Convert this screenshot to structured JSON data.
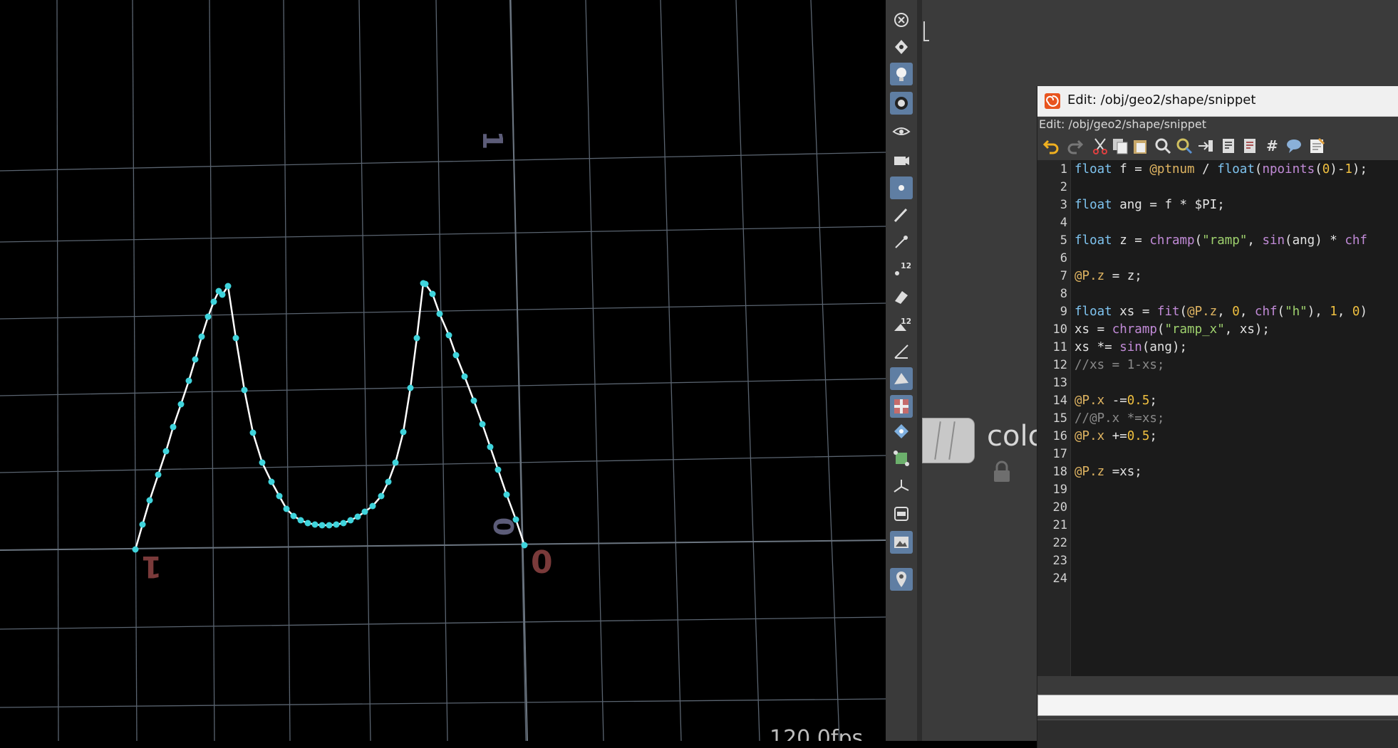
{
  "viewport": {
    "fps_text": "120.0fps",
    "axis_labels": {
      "y_top": "1",
      "x_left": "1",
      "z_origin": "0",
      "x_origin": "0"
    },
    "colors": {
      "grid": "#5a6470",
      "curve": "#ffffff",
      "points": "#3fd4dc",
      "y_label": "#5c5c78",
      "x_label": "#7a3a3a"
    }
  },
  "toolbar": {
    "icons": [
      "close-icon",
      "snap-icon",
      "light-icon",
      "camera-handle-icon",
      "view-eye-icon",
      "view-camera-icon",
      "point-icon",
      "brush-icon",
      "pen-icon",
      "point-number-icon",
      "paint-icon",
      "prim-number-icon",
      "normals-icon",
      "shaded-icon",
      "texture-icon",
      "guide-icon",
      "geometry-icon",
      "axis-icon",
      "ortho-icon",
      "background-image-icon",
      "pin-icon"
    ],
    "active_icons": [
      "light-icon",
      "camera-handle-icon",
      "point-icon",
      "shaded-icon",
      "texture-icon",
      "background-image-icon",
      "pin-icon"
    ]
  },
  "network": {
    "node_label": "colo",
    "lock_icon": "lock-icon"
  },
  "editor": {
    "window_title": "Edit: /obj/geo2/shape/snippet",
    "subtitle": "Edit: /obj/geo2/shape/snippet",
    "tools": [
      "undo-icon",
      "redo-icon",
      "cut-icon",
      "copy-icon",
      "paste-icon",
      "find-icon",
      "find-replace-icon",
      "goto-icon",
      "comment-icon",
      "uncomment-icon",
      "hash-icon",
      "speech-icon",
      "notepad-icon"
    ],
    "line_numbers": [
      "1",
      "2",
      "3",
      "4",
      "5",
      "6",
      "7",
      "8",
      "9",
      "10",
      "11",
      "12",
      "13",
      "14",
      "15",
      "16",
      "17",
      "18",
      "19",
      "20",
      "21",
      "22",
      "23",
      "24"
    ],
    "code_lines": [
      [
        [
          "kw",
          "float"
        ],
        [
          "p",
          " f = "
        ],
        [
          "var",
          "@ptnum"
        ],
        [
          "p",
          " / "
        ],
        [
          "kw",
          "float"
        ],
        [
          "p",
          "("
        ],
        [
          "fn",
          "npoints"
        ],
        [
          "p",
          "("
        ],
        [
          "num",
          "0"
        ],
        [
          "p",
          ")-"
        ],
        [
          "num",
          "1"
        ],
        [
          "p",
          ");"
        ]
      ],
      [],
      [
        [
          "kw",
          "float"
        ],
        [
          "p",
          " ang = f * $PI;"
        ]
      ],
      [],
      [
        [
          "kw",
          "float"
        ],
        [
          "p",
          " z = "
        ],
        [
          "fn",
          "chramp"
        ],
        [
          "p",
          "("
        ],
        [
          "str",
          "\"ramp\""
        ],
        [
          "p",
          ", "
        ],
        [
          "fn",
          "sin"
        ],
        [
          "p",
          "(ang) * "
        ],
        [
          "fn",
          "chf"
        ]
      ],
      [],
      [
        [
          "var",
          "@P.z"
        ],
        [
          "p",
          " = z;"
        ]
      ],
      [],
      [
        [
          "kw",
          "float"
        ],
        [
          "p",
          " xs = "
        ],
        [
          "fn",
          "fit"
        ],
        [
          "p",
          "("
        ],
        [
          "var",
          "@P.z"
        ],
        [
          "p",
          ", "
        ],
        [
          "num",
          "0"
        ],
        [
          "p",
          ", "
        ],
        [
          "fn",
          "chf"
        ],
        [
          "p",
          "("
        ],
        [
          "str",
          "\"h\""
        ],
        [
          "p",
          "), "
        ],
        [
          "num",
          "1"
        ],
        [
          "p",
          ", "
        ],
        [
          "num",
          "0"
        ],
        [
          "p",
          ")"
        ]
      ],
      [
        [
          "p",
          "xs = "
        ],
        [
          "fn",
          "chramp"
        ],
        [
          "p",
          "("
        ],
        [
          "str",
          "\"ramp_x\""
        ],
        [
          "p",
          ", xs);"
        ]
      ],
      [
        [
          "p",
          "xs *= "
        ],
        [
          "fn",
          "sin"
        ],
        [
          "p",
          "(ang);"
        ]
      ],
      [
        [
          "cm",
          "//xs = 1-xs;"
        ]
      ],
      [],
      [
        [
          "var",
          "@P.x"
        ],
        [
          "p",
          " -="
        ],
        [
          "num",
          "0.5"
        ],
        [
          "p",
          ";"
        ]
      ],
      [
        [
          "cm",
          "//@P.x *=xs;"
        ]
      ],
      [
        [
          "var",
          "@P.x"
        ],
        [
          "p",
          " +="
        ],
        [
          "num",
          "0.5"
        ],
        [
          "p",
          ";"
        ]
      ],
      [],
      [
        [
          "var",
          "@P.z"
        ],
        [
          "p",
          " =xs;"
        ]
      ],
      [],
      [],
      [],
      [],
      [],
      []
    ]
  }
}
